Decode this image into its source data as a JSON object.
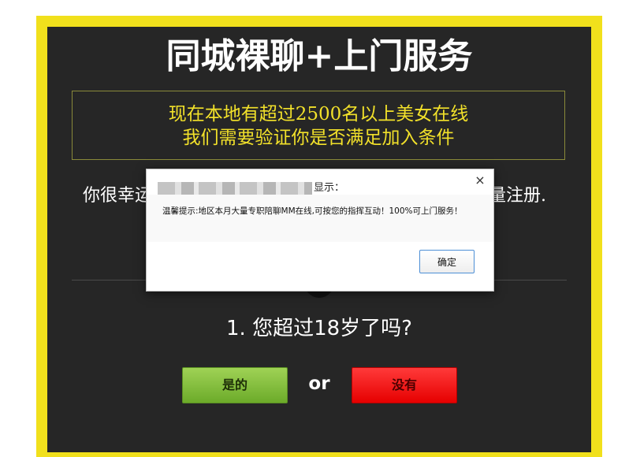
{
  "page": {
    "title": "同城裸聊+上门服务",
    "notice_line1": "现在本地有超过2500名以上美女在线",
    "notice_line2": "我们需要验证你是否满足加入条件",
    "lucky_left": "你很幸运",
    "lucky_right": "量注册.",
    "question": "1. 您超过18岁了吗?",
    "yes_label": "是的",
    "or_label": "or",
    "no_label": "没有"
  },
  "dialog": {
    "header_suffix": "显示：",
    "close_glyph": "×",
    "close_icon": "close-icon",
    "message": "温馨提示:地区本月大量专职陪聊MM在线,可按您的指挥互动！100%可上门服务！",
    "ok_label": "确定"
  },
  "colors": {
    "frame": "#f1e01c",
    "panel": "#262626",
    "notice_text": "#f2e12a",
    "yes_button": "#7fbb36",
    "no_button": "#ff1a1a",
    "ok_border": "#4d8fd6"
  }
}
